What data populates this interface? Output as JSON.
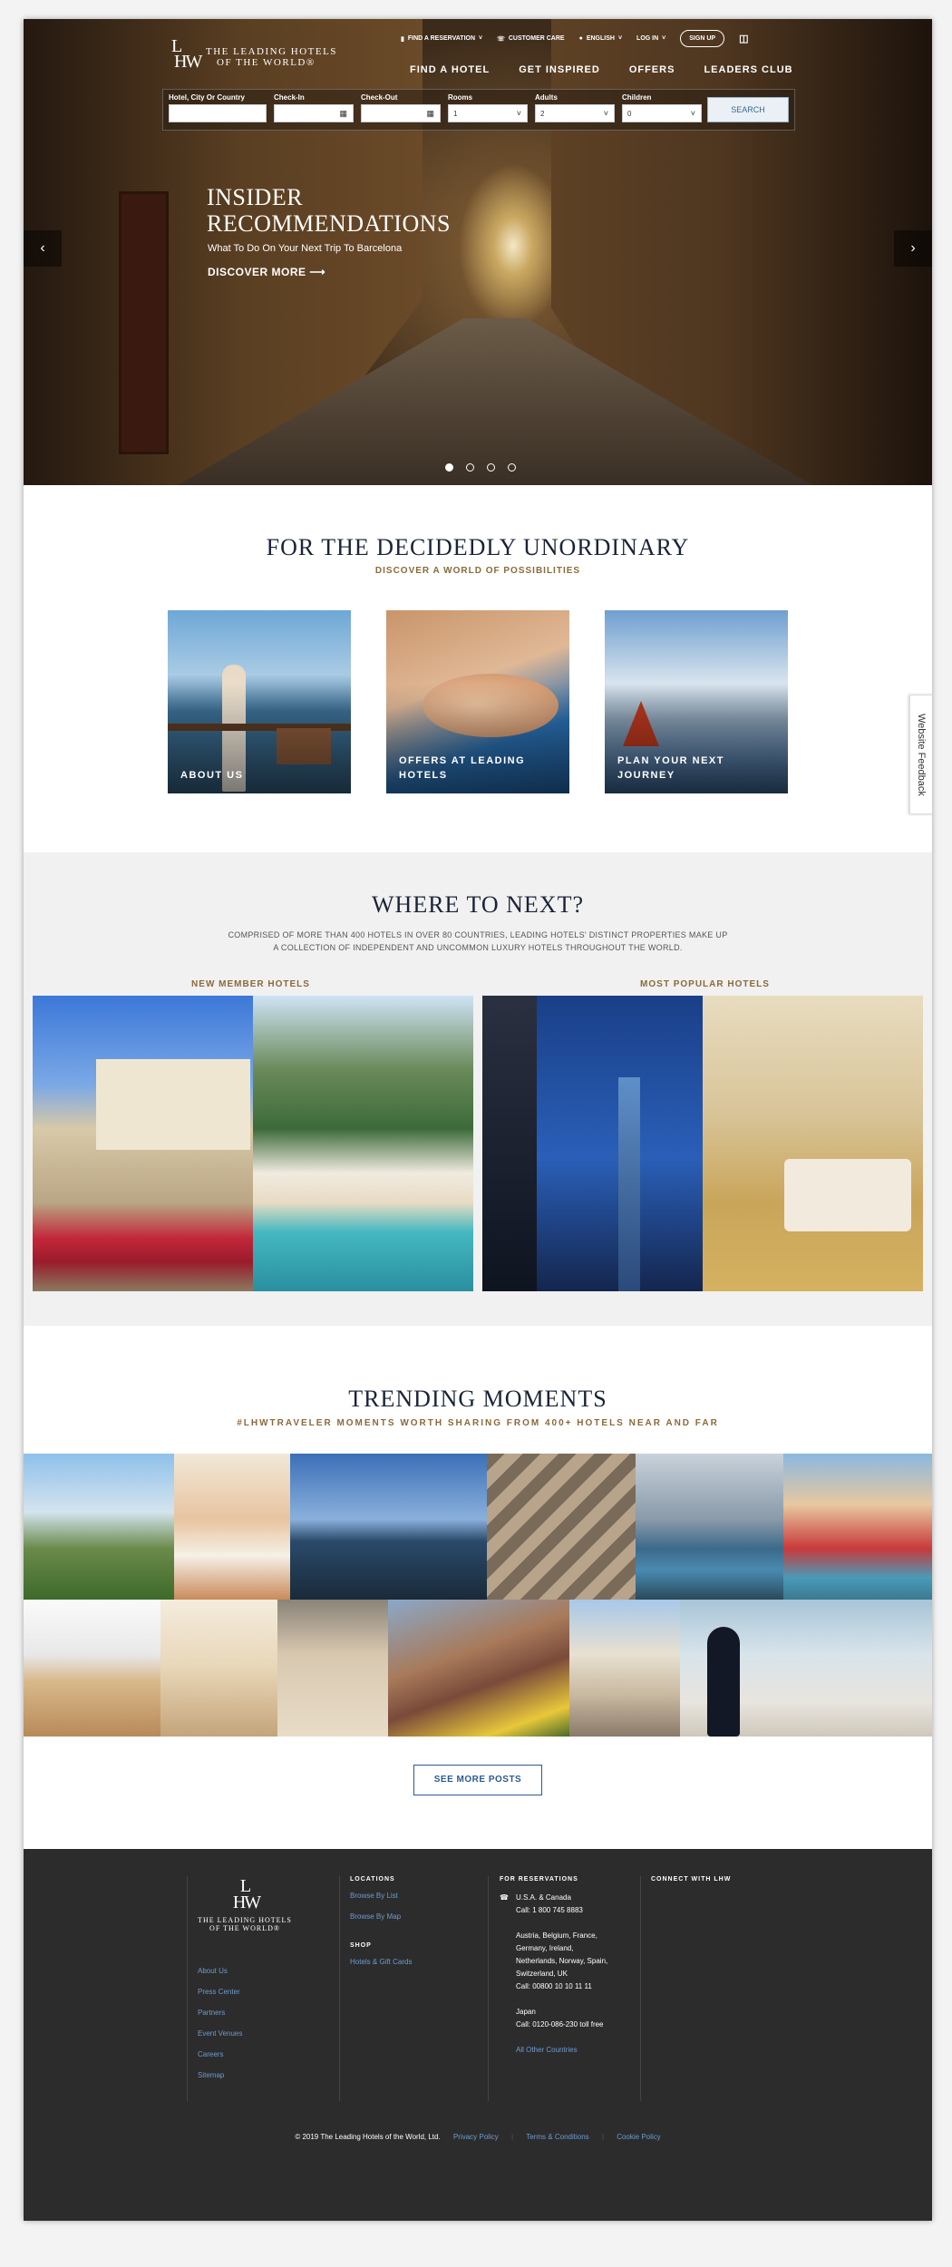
{
  "brand": {
    "name_line1": "THE LEADING HOTELS",
    "name_line2": "OF THE WORLD®",
    "mark": "LHW"
  },
  "topnav": {
    "reservation": "FIND A RESERVATION",
    "care": "CUSTOMER CARE",
    "language": "ENGLISH",
    "login": "LOG IN",
    "signup": "SIGN UP"
  },
  "mainnav": [
    "FIND A HOTEL",
    "GET INSPIRED",
    "OFFERS",
    "LEADERS CLUB"
  ],
  "search": {
    "dest_label": "Hotel, City Or Country",
    "checkin_label": "Check-In",
    "checkout_label": "Check-Out",
    "rooms_label": "Rooms",
    "rooms_value": "1",
    "adults_label": "Adults",
    "adults_value": "2",
    "children_label": "Children",
    "children_value": "0",
    "button": "SEARCH"
  },
  "hero": {
    "title_line1": "INSIDER",
    "title_line2": "RECOMMENDATIONS",
    "subtitle": "What To Do On Your Next Trip To Barcelona",
    "cta": "DISCOVER MORE ⟶",
    "slides": 4,
    "active_slide": 1
  },
  "intro": {
    "heading": "FOR THE DECIDEDLY UNORDINARY",
    "kicker": "DISCOVER A WORLD OF POSSIBILITIES"
  },
  "cards": [
    {
      "label": "ABOUT US"
    },
    {
      "label": "OFFERS AT LEADING HOTELS"
    },
    {
      "label": "PLAN YOUR NEXT JOURNEY"
    }
  ],
  "where": {
    "heading": "WHERE TO NEXT?",
    "line1": "COMPRISED OF MORE THAN 400 HOTELS IN OVER 80 COUNTRIES, LEADING HOTELS' DISTINCT PROPERTIES MAKE UP",
    "line2": "A COLLECTION OF INDEPENDENT AND UNCOMMON LUXURY HOTELS THROUGHOUT THE WORLD.",
    "new_label": "NEW MEMBER HOTELS",
    "popular_label": "MOST POPULAR HOTELS"
  },
  "trending": {
    "heading": "TRENDING MOMENTS",
    "kicker": "#LHWTRAVELER MOMENTS WORTH SHARING FROM 400+ HOTELS NEAR AND FAR",
    "see_more": "SEE MORE POSTS"
  },
  "footer": {
    "links": [
      "About Us",
      "Press Center",
      "Partners",
      "Event Venues",
      "Careers",
      "Sitemap"
    ],
    "locations_title": "LOCATIONS",
    "locations": [
      "Browse By List",
      "Browse By Map"
    ],
    "shop_title": "SHOP",
    "shop": [
      "Hotels & Gift Cards"
    ],
    "res_title": "FOR RESERVATIONS",
    "res_us": "U.S.A. & Canada",
    "res_us_call": "Call: 1 800 745 8883",
    "res_eu1": "Austria, Belgium, France,",
    "res_eu2": "Germany, Ireland,",
    "res_eu3": "Netherlands, Norway, Spain,",
    "res_eu4": "Switzerland, UK",
    "res_eu_call": "Call: 00800 10 10 11 11",
    "res_jp": "Japan",
    "res_jp_call": "Call: 0120-086-230 toll free",
    "res_other": "All Other Countries",
    "connect_title": "CONNECT WITH LHW",
    "copyright": "© 2019 The Leading Hotels of the World, Ltd.",
    "privacy": "Privacy Policy",
    "terms": "Terms & Conditions",
    "cookie": "Cookie Policy"
  },
  "feedback": "Website Feedback"
}
